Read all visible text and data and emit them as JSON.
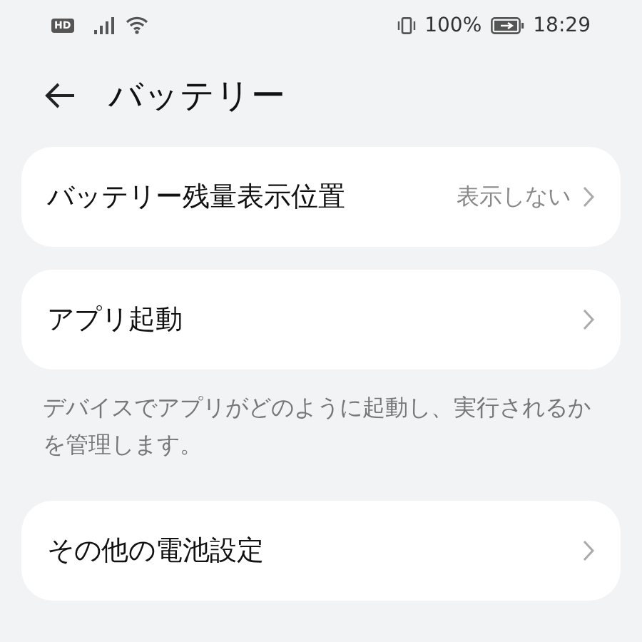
{
  "status_bar": {
    "hd_badge": "HD",
    "battery_percent": "100%",
    "time": "18:29"
  },
  "header": {
    "title": "バッテリー"
  },
  "cards": [
    {
      "label": "バッテリー残量表示位置",
      "value": "表示しない"
    },
    {
      "label": "アプリ起動",
      "footer": "デバイスでアプリがどのように起動し、実行されるかを管理します。"
    },
    {
      "label": "その他の電池設定"
    }
  ]
}
